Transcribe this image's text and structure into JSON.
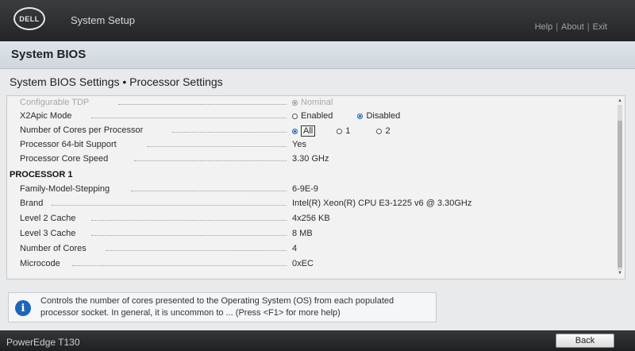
{
  "header": {
    "logo_text": "DELL",
    "app_title": "System Setup",
    "links": [
      "Help",
      "About",
      "Exit"
    ]
  },
  "section_title": "System BIOS",
  "page_title": "System BIOS Settings • Processor Settings",
  "settings": {
    "configurable_tdp": {
      "label": "Configurable TDP",
      "options": [
        "Nominal"
      ],
      "selected": "Nominal",
      "disabled": true
    },
    "x2apic_mode": {
      "label": "X2Apic Mode",
      "options": [
        "Enabled",
        "Disabled"
      ],
      "selected": "Disabled"
    },
    "cores_per_processor": {
      "label": "Number of Cores per Processor",
      "options": [
        "All",
        "1",
        "2"
      ],
      "selected": "All"
    },
    "processor_64bit": {
      "label": "Processor 64-bit Support",
      "value": "Yes"
    },
    "core_speed": {
      "label": "Processor Core Speed",
      "value": "3.30 GHz"
    }
  },
  "processor1": {
    "heading": "PROCESSOR 1",
    "family_model_stepping": {
      "label": "Family-Model-Stepping",
      "value": "6-9E-9"
    },
    "brand": {
      "label": "Brand",
      "value": "Intel(R) Xeon(R) CPU E3-1225 v6 @ 3.30GHz"
    },
    "l2_cache": {
      "label": "Level 2 Cache",
      "value": "4x256 KB"
    },
    "l3_cache": {
      "label": "Level 3 Cache",
      "value": "8 MB"
    },
    "num_cores": {
      "label": "Number of Cores",
      "value": "4"
    },
    "microcode": {
      "label": "Microcode",
      "value": "0xEC"
    }
  },
  "help": {
    "icon": "info-icon",
    "text": "Controls the number of cores presented to the Operating System (OS) from each populated processor socket. In general, it is uncommon to ... (Press <F1> for more help)"
  },
  "footer": {
    "model": "PowerEdge T130",
    "back_label": "Back"
  },
  "colors": {
    "header_bg": "#2c2e31",
    "accent_blue": "#1f5fb0",
    "panel_bg": "#f2f2f2"
  }
}
